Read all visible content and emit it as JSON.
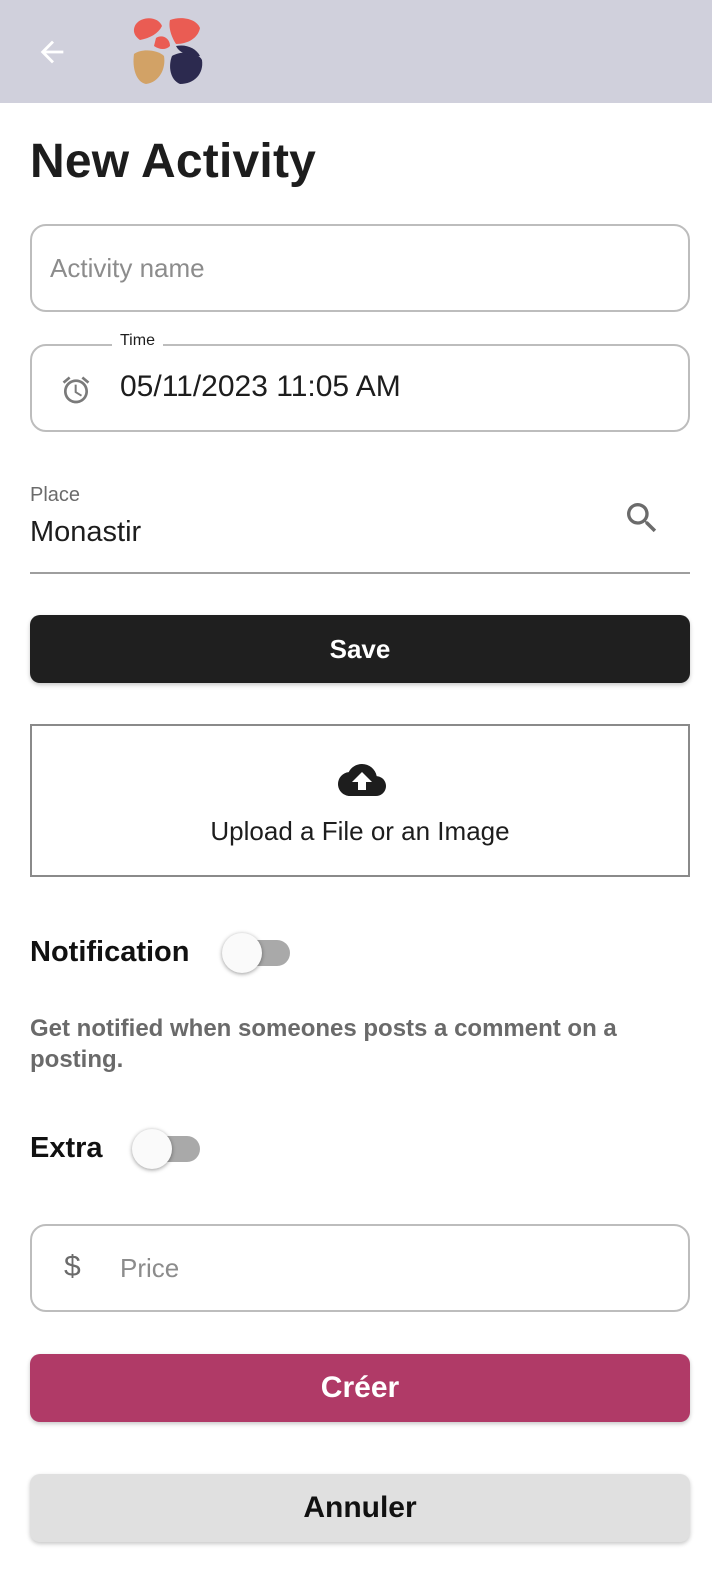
{
  "header": {
    "back_icon": "arrow-left-icon",
    "logo": "app-logo",
    "colors": {
      "bar": "#d0d0dc",
      "logo_red": "#ea5c53",
      "logo_tan": "#d2a266",
      "logo_navy": "#2c2a4f"
    }
  },
  "page": {
    "title": "New Activity"
  },
  "form": {
    "activity_name": {
      "placeholder": "Activity name",
      "value": ""
    },
    "time": {
      "label": "Time",
      "value": "05/11/2023 11:05 AM",
      "icon": "alarm-icon"
    },
    "place": {
      "label": "Place",
      "value": "Monastir",
      "icon": "search-icon"
    },
    "save_label": "Save",
    "upload": {
      "label": "Upload a File or an Image",
      "icon": "cloud-upload-icon"
    },
    "notification": {
      "label": "Notification",
      "enabled": false,
      "description": "Get notified when someones posts a comment on a posting."
    },
    "extra": {
      "label": "Extra",
      "enabled": false
    },
    "price": {
      "placeholder": "Price",
      "prefix": "$",
      "value": ""
    }
  },
  "actions": {
    "create_label": "Créer",
    "cancel_label": "Annuler",
    "colors": {
      "create": "#b03a67",
      "cancel": "#e0e0e0",
      "save": "#1f1f1f"
    }
  }
}
